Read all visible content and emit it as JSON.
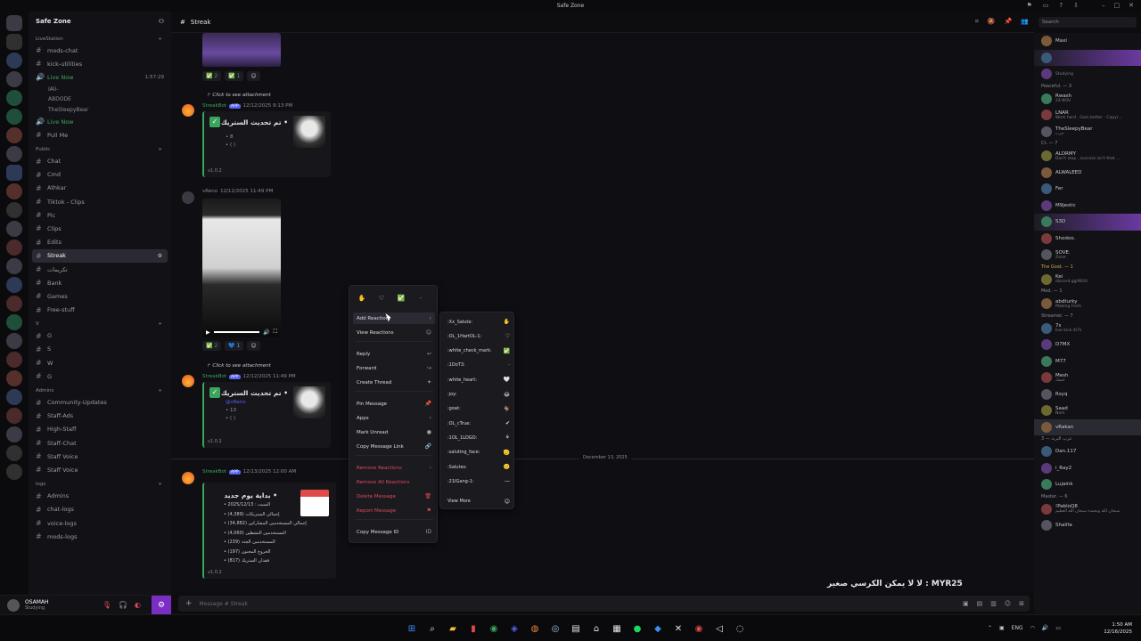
{
  "window": {
    "title": "Safe Zone"
  },
  "guild": {
    "name": "Safe Zone"
  },
  "channels": {
    "sections": [
      {
        "kind": "cat",
        "label": "LiveStation"
      },
      {
        "kind": "text",
        "label": "mods-chat"
      },
      {
        "kind": "text",
        "label": "kick-utilities"
      },
      {
        "kind": "live",
        "label": "Live Now",
        "time": "1:57:29"
      },
      {
        "kind": "sub",
        "label": "IAli-"
      },
      {
        "kind": "sub",
        "label": "ABDODE"
      },
      {
        "kind": "sub",
        "label": "TheSleepyBear"
      },
      {
        "kind": "live",
        "label": "Live Now"
      },
      {
        "kind": "text",
        "label": "Pull Me"
      },
      {
        "kind": "cat",
        "label": "Public"
      },
      {
        "kind": "text",
        "label": "Chat"
      },
      {
        "kind": "text",
        "label": "Cmd"
      },
      {
        "kind": "text",
        "label": "Athkar"
      },
      {
        "kind": "text",
        "label": "Tiktok - Clips"
      },
      {
        "kind": "text",
        "label": "Pic"
      },
      {
        "kind": "text",
        "label": "Clips"
      },
      {
        "kind": "text",
        "label": "Edits"
      },
      {
        "kind": "active",
        "label": "Streak"
      },
      {
        "kind": "text",
        "label": "تكريمات"
      },
      {
        "kind": "text",
        "label": "Bank"
      },
      {
        "kind": "text",
        "label": "Games"
      },
      {
        "kind": "text",
        "label": "Free-stuff"
      },
      {
        "kind": "cat",
        "label": "V"
      },
      {
        "kind": "text",
        "label": "G"
      },
      {
        "kind": "text",
        "label": "S"
      },
      {
        "kind": "text",
        "label": "W"
      },
      {
        "kind": "text",
        "label": "G"
      },
      {
        "kind": "cat",
        "label": "Admins"
      },
      {
        "kind": "text",
        "label": "Community-Updates"
      },
      {
        "kind": "text",
        "label": "Staff-Ads"
      },
      {
        "kind": "text",
        "label": "High-Staff"
      },
      {
        "kind": "text",
        "label": "Staff-Chat"
      },
      {
        "kind": "text",
        "label": "Staff Voice"
      },
      {
        "kind": "text",
        "label": "Staff Voice"
      },
      {
        "kind": "cat",
        "label": "logs"
      },
      {
        "kind": "text",
        "label": "Admins"
      },
      {
        "kind": "text",
        "label": "chat-logs"
      },
      {
        "kind": "text",
        "label": "voice-logs"
      },
      {
        "kind": "text",
        "label": "mods-logs"
      }
    ]
  },
  "user": {
    "name": "OSAMAH",
    "status": "Studying"
  },
  "chat": {
    "channel": "Streak",
    "composer_placeholder": "Message # Streak",
    "reactions1": [
      "✅ 2",
      "✅ 1",
      "☺"
    ],
    "msg1": {
      "reply": "Click to see attachment",
      "author": "StreakBot",
      "app": "APP",
      "time": "12/12/2025 9:13 PM",
      "embed_title": "تم تحديث الستريك •",
      "line1": "• 8",
      "line2": "• ( )",
      "version": "v1.0.2"
    },
    "msg2": {
      "author": "vReno",
      "time": "12/12/2025 11:49 PM"
    },
    "reactions2": [
      "✅ 2",
      "💙 1",
      "☺"
    ],
    "msg3": {
      "reply": "Click to see attachment",
      "author": "StreakBot",
      "app": "APP",
      "time": "12/12/2025 11:49 PM",
      "embed_title": "تم تحديث الستريك •",
      "mention": "@vReno",
      "line1": "• 13",
      "line2": "• ( )",
      "version": "v1.0.2"
    },
    "date_divider": "December 13, 2025",
    "msg4": {
      "author": "StreakBot",
      "app": "APP",
      "time": "12/13/2025 12:00 AM",
      "embed_title": "بداية يوم جديد •",
      "rows": [
        "• 2025/12/13 : السبت",
        "• (4,389) إجمالي الستريكات",
        "• (34,882) إجمالي المستخدمين المشاركين",
        "• (4,060) المستخدمين النشطين",
        "• (239) المستخدمين الجدد",
        "• (197) الخروج المجنون",
        "• (817) فقدان الستريك"
      ],
      "version": "v1.0.2"
    },
    "marquee": "لا لا يمكن الكرسي صغير : MYR25"
  },
  "context_menu": {
    "items": [
      {
        "label": "Add Reaction",
        "icon": "›"
      },
      {
        "label": "View Reactions",
        "icon": "☺"
      },
      {
        "label": "Reply",
        "icon": "↩"
      },
      {
        "label": "Forward",
        "icon": "↪"
      },
      {
        "label": "Create Thread",
        "icon": "✦"
      },
      {
        "label": "Pin Message",
        "icon": "📌"
      },
      {
        "label": "Apps",
        "icon": "›"
      },
      {
        "label": "Mark Unread",
        "icon": "●"
      },
      {
        "label": "Copy Message Link",
        "icon": "🔗"
      },
      {
        "label": "Remove Reactions",
        "icon": "›"
      },
      {
        "label": "Remove All Reactions",
        "icon": ""
      },
      {
        "label": "Delete Message",
        "icon": "🗑"
      },
      {
        "label": "Report Message",
        "icon": "⚑"
      },
      {
        "label": "Copy Message ID",
        "icon": "ID"
      }
    ]
  },
  "reaction_submenu": {
    "items": [
      {
        "label": ":Xx_Salute:",
        "icon": "✋"
      },
      {
        "label": ":OL_1HartOL-1:",
        "icon": "♡"
      },
      {
        "label": ":white_check_mark:",
        "icon": "✅"
      },
      {
        "label": ":1DoT3:",
        "icon": "·"
      },
      {
        "label": ":white_heart:",
        "icon": "🤍"
      },
      {
        "label": ":joy:",
        "icon": "😂"
      },
      {
        "label": ":goat:",
        "icon": "🐐"
      },
      {
        "label": ":OL_cTrue:",
        "icon": "✔"
      },
      {
        "label": ":1OL_1LOGO:",
        "icon": "⚘"
      },
      {
        "label": ":saluting_face:",
        "icon": "🫡"
      },
      {
        "label": ":Salutes:",
        "icon": "🙂"
      },
      {
        "label": ":21IGang-1:",
        "icon": "—"
      },
      {
        "label": "View More",
        "icon": "☺"
      }
    ]
  },
  "members": {
    "groups": [
      {
        "label": "",
        "members": [
          {
            "name": "Maxi",
            "status": ""
          },
          {
            "name": "",
            "status": ""
          },
          {
            "name": "",
            "status": "Studying"
          }
        ]
      },
      {
        "label": "Peaceful. — 3",
        "members": [
          {
            "name": "Rwash",
            "status": "24 NOV"
          },
          {
            "name": "LNAR",
            "status": "Work hard , Gain better - Copyr..."
          },
          {
            "name": "TheSleepyBear",
            "status": "حرب"
          }
        ]
      },
      {
        "label": "Ct. — 7",
        "members": [
          {
            "name": "ALDRMY",
            "status": "Don't stop , success isn't that ..."
          },
          {
            "name": "ALWALEED",
            "status": ""
          },
          {
            "name": "Fer",
            "status": ""
          },
          {
            "name": "M9jestic",
            "status": ""
          },
          {
            "name": "S3D",
            "status": ""
          },
          {
            "name": "Shodoo.",
            "status": ""
          },
          {
            "name": "SOVE.",
            "status": "Zone"
          }
        ]
      },
      {
        "label": "The Goat. — 1",
        "gold": true,
        "members": [
          {
            "name": "Kei",
            "status": "discord.gg/WUU"
          }
        ]
      },
      {
        "label": "Med. — 1",
        "members": [
          {
            "name": "abdturky",
            "status": "Making Form"
          }
        ]
      },
      {
        "label": "Streamer. — 7",
        "members": [
          {
            "name": "7s",
            "status": "live kick it/7s"
          },
          {
            "name": "D7MX",
            "status": ""
          },
          {
            "name": "M77",
            "status": ""
          },
          {
            "name": "Mesh",
            "status": "حسك"
          },
          {
            "name": "Rsyq",
            "status": ""
          },
          {
            "name": "Saad",
            "status": "Nom"
          },
          {
            "name": "vRakan",
            "status": ""
          }
        ]
      },
      {
        "label": "عرب الترند — 3",
        "members": [
          {
            "name": "Dan.117",
            "status": ""
          },
          {
            "name": "i_Ray2",
            "status": ""
          },
          {
            "name": "Lujaink",
            "status": ""
          }
        ]
      },
      {
        "label": "Master. — 6",
        "members": [
          {
            "name": "!PabloQ8",
            "status": "سبحان الله وبحمده سبحان الله العظيم"
          },
          {
            "name": "Shalifa",
            "status": ""
          }
        ]
      }
    ]
  },
  "search": {
    "placeholder": "Search"
  },
  "clock": {
    "time": "1:50 AM",
    "date": "12/16/2025"
  },
  "tray": {
    "lang": "ENG"
  }
}
